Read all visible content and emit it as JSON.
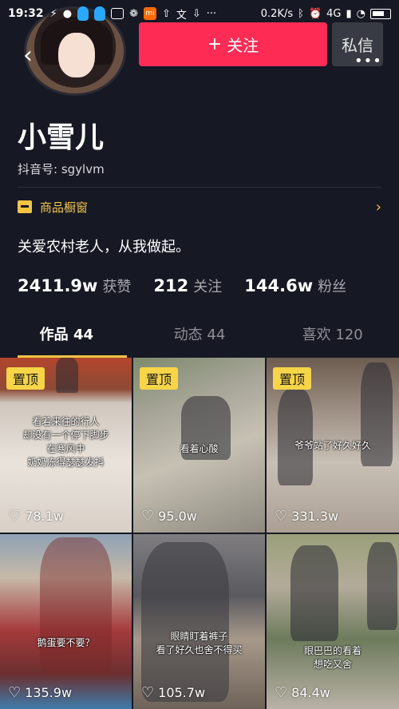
{
  "status_bar": {
    "time": "19:32",
    "net_speed": "0.2K/s",
    "network": "4G",
    "battery_icon": "battery-icon"
  },
  "header": {
    "follow_label": "关注",
    "message_label": "私信",
    "back_icon": "back-icon",
    "more_icon": "more-icon"
  },
  "profile": {
    "name": "小雪儿",
    "douyin_id": "抖音号: sgylvm",
    "shop_label": "商品橱窗",
    "bio": "关爱农村老人，从我做起。"
  },
  "stats": [
    {
      "num": "2411.9w",
      "label": "获赞"
    },
    {
      "num": "212",
      "label": "关注"
    },
    {
      "num": "144.6w",
      "label": "粉丝"
    }
  ],
  "tabs": [
    {
      "label": "作品 44"
    },
    {
      "label": "动态 44"
    },
    {
      "label": "喜欢 120"
    }
  ],
  "videos": [
    {
      "pinned": "置顶",
      "caption": [
        "看着来往的行人",
        "却没有一个停下脚步",
        "在寒风中",
        "奶奶冻得瑟瑟发抖"
      ],
      "likes": "78.1w"
    },
    {
      "pinned": "置顶",
      "caption": [
        "看着心酸"
      ],
      "likes": "95.0w"
    },
    {
      "pinned": "置顶",
      "caption": [
        "爷爷站了好久好久"
      ],
      "likes": "331.3w"
    },
    {
      "pinned": "",
      "caption": [
        "鹅蛋要不要？"
      ],
      "likes": "135.9w"
    },
    {
      "pinned": "",
      "caption": [
        "眼睛盯着裤子",
        "看了好久也舍不得买"
      ],
      "likes": "105.7w"
    },
    {
      "pinned": "",
      "caption": [
        "眼巴巴的看着",
        "想吃又舍"
      ],
      "likes": "84.4w"
    }
  ]
}
